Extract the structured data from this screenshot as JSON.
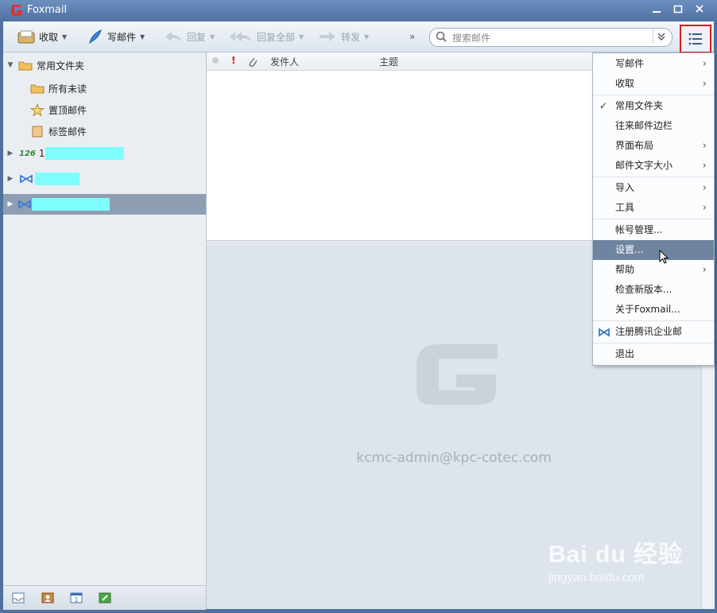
{
  "window": {
    "title": "Foxmail"
  },
  "toolbar": {
    "receive": "收取",
    "compose": "写邮件",
    "reply": "回复",
    "reply_all": "回复全部",
    "forward": "转发",
    "more": "»",
    "search_placeholder": "搜索邮件"
  },
  "sidebar": {
    "common_folder": "常用文件夹",
    "items": [
      {
        "label": "所有未读",
        "icon": "folder-icon"
      },
      {
        "label": "置顶邮件",
        "icon": "star-icon"
      },
      {
        "label": "标签邮件",
        "icon": "tag-icon"
      }
    ],
    "accounts": [
      {
        "prefix": "126",
        "text": "1"
      },
      {
        "prefix": "",
        "text": ""
      },
      {
        "prefix": "",
        "text": ""
      }
    ]
  },
  "list": {
    "col_sender": "发件人",
    "col_subject": "主题"
  },
  "preview": {
    "account_email": "kcmc-admin@kpc-cotec.com"
  },
  "menu": {
    "items": [
      {
        "label": "写邮件",
        "submenu": true
      },
      {
        "label": "收取",
        "submenu": true
      },
      {
        "label": "常用文件夹",
        "checked": true
      },
      {
        "label": "往来邮件边栏"
      },
      {
        "label": "界面布局",
        "submenu": true
      },
      {
        "label": "邮件文字大小",
        "submenu": true
      },
      {
        "label": "导入",
        "submenu": true
      },
      {
        "label": "工具",
        "submenu": true
      },
      {
        "label": "帐号管理..."
      },
      {
        "label": "设置...",
        "highlighted": true
      },
      {
        "label": "帮助",
        "submenu": true
      },
      {
        "label": "检查新版本..."
      },
      {
        "label": "关于Foxmail..."
      },
      {
        "label": "注册腾讯企业邮"
      },
      {
        "label": "退出"
      }
    ]
  },
  "watermark": {
    "brand": "Bai du 经验",
    "url": "jingyan.baidu.com"
  },
  "colors": {
    "accent": "#4f71a0",
    "selected_row": "#8e9fb4",
    "highlight_menu": "#6f859f",
    "focus_border": "#d21f1f"
  }
}
